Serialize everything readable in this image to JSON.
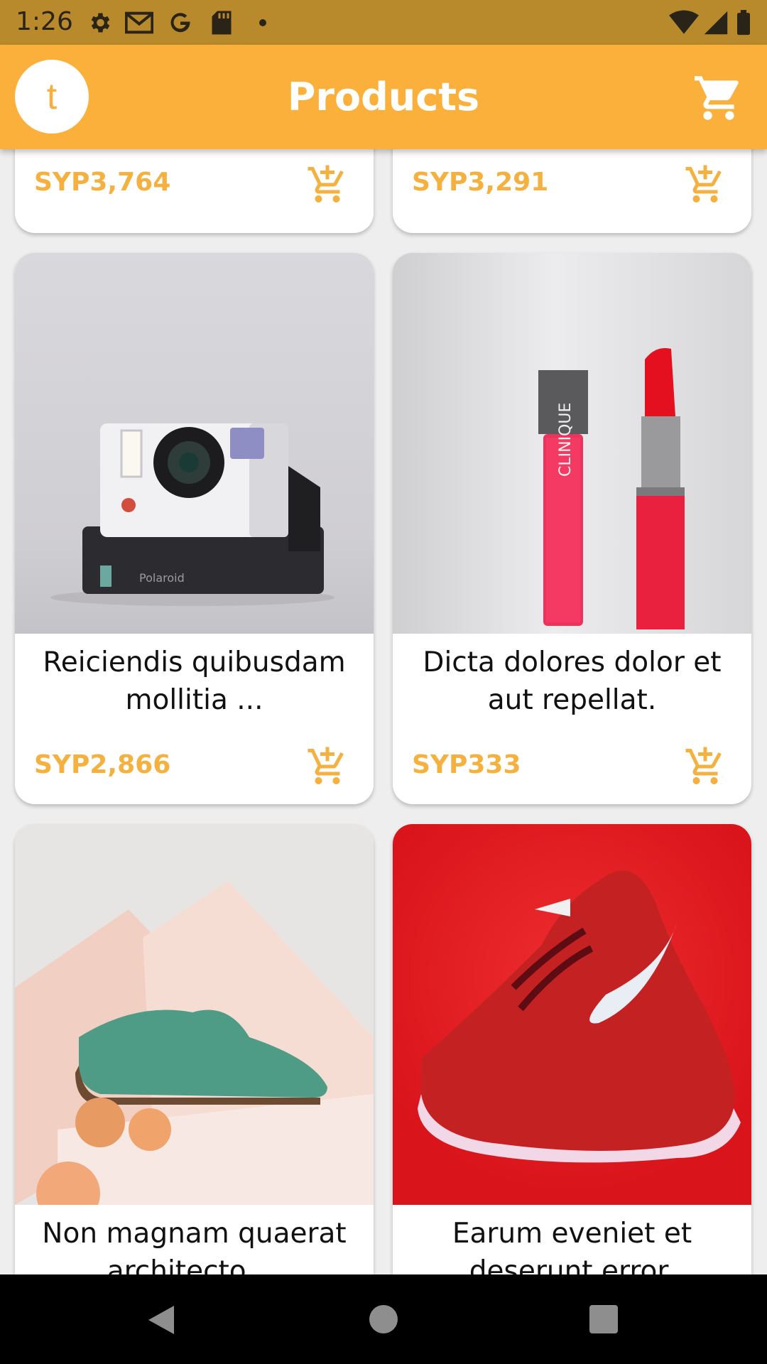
{
  "status_bar": {
    "time": "1:26",
    "icons": [
      "gear-icon",
      "gmail-icon",
      "google-icon",
      "sd-card-icon",
      "dot-icon",
      "wifi-icon",
      "signal-icon",
      "battery-icon"
    ]
  },
  "app_bar": {
    "avatar_letter": "t",
    "title": "Products",
    "cart_icon": "cart-icon",
    "background": "#fbb03b"
  },
  "products": [
    {
      "name": "",
      "price": "SYP3,764"
    },
    {
      "name": "",
      "price": "SYP3,291"
    },
    {
      "name": "Reiciendis quibusdam mollitia ...",
      "price": "SYP2,866"
    },
    {
      "name": "Dicta dolores dolor et aut repellat.",
      "price": "SYP333"
    },
    {
      "name": "Non magnam quaerat architecto ...",
      "price": ""
    },
    {
      "name": "Earum eveniet et deserunt error.",
      "price": ""
    }
  ],
  "colors": {
    "accent": "#fbb03b",
    "price": "#f5b13f"
  },
  "nav_bar": {
    "icons": [
      "back-icon",
      "home-icon",
      "recents-icon"
    ]
  }
}
